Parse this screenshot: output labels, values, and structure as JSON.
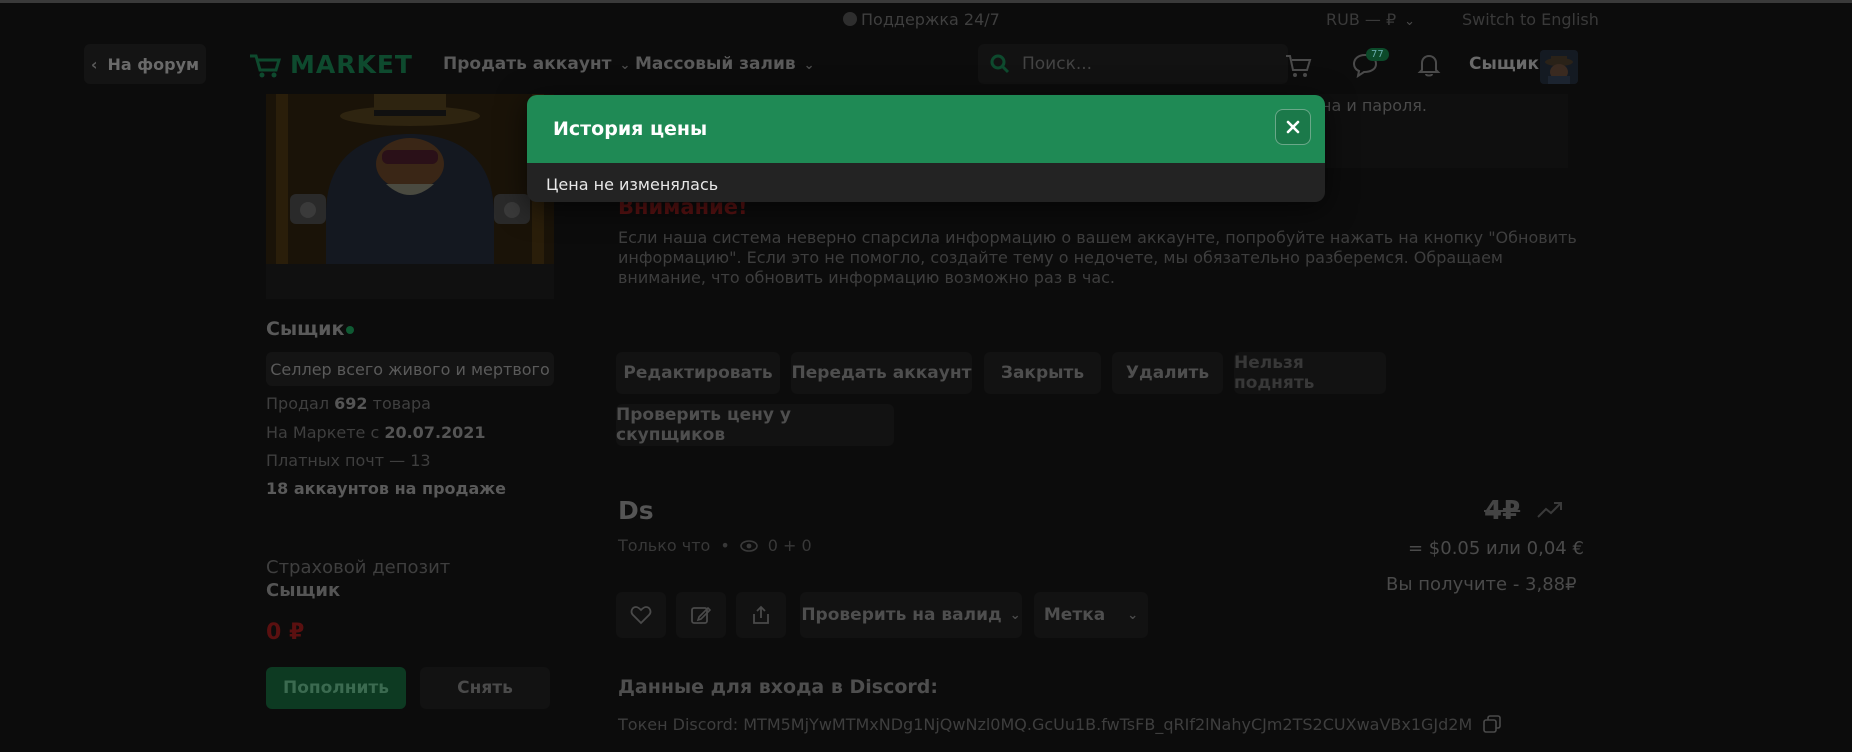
{
  "topbar": {
    "support": "Поддержка 24/7",
    "currency": "RUB — ₽",
    "language": "Switch to English"
  },
  "header": {
    "back": "На форум",
    "logo": "MARKET",
    "nav_sell": "Продать аккаунт",
    "nav_mass": "Массовый залив",
    "search_placeholder": "Поиск...",
    "messages_badge": "77",
    "username": "Сыщик"
  },
  "notice": {
    "text_fragment": "на и пароля."
  },
  "seller": {
    "name": "Сыщик",
    "tag": "Селлер всего живого и мертвого",
    "sold_prefix": "Продал ",
    "sold_count": "692",
    "sold_suffix": " товара",
    "since_prefix": "На Маркете с ",
    "since_date": "20.07.2021",
    "paid_mail_prefix": "Платных почт — ",
    "paid_mail_count": "13",
    "on_sale": "18 аккаунтов на продаже"
  },
  "deposit": {
    "label": "Страховой депозит",
    "name": "Сыщик",
    "amount": "0 ₽",
    "topup": "Пополнить",
    "withdraw": "Снять"
  },
  "warning": {
    "title": "Внимание!",
    "text": "Если наша система неверно спарсила информацию о вашем аккаунте, попробуйте нажать на кнопку \"Обновить информацию\". Если это не помогло, создайте тему о недочете, мы обязательно разберемся. Обращаем внимание, что обновить информацию возможно раз в час."
  },
  "actions": {
    "edit": "Редактировать",
    "transfer": "Передать аккаунт",
    "close": "Закрыть",
    "delete": "Удалить",
    "cant_bump": "Нельзя поднять",
    "check_price": "Проверить цену у скупщиков"
  },
  "account": {
    "title": "Ds",
    "time": "Только что",
    "views": "0 + 0",
    "price": "4₽",
    "conversion": "= $0.05 или 0,04 €",
    "receive": "Вы получите - 3,88₽",
    "check_valid": "Проверить на валид",
    "tag": "Метка",
    "login_title": "Данные для входа в Discord:",
    "token_label": "Токен Discord: ",
    "token": "MTM5MjYwMTMxNDg1NjQwNzl0MQ.GcUu1B.fwTsFB_qRIf2lNahyCJm2TS2CUXwaVBx1GJd2M"
  },
  "modal": {
    "title": "История цены",
    "body": "Цена не изменялась"
  }
}
